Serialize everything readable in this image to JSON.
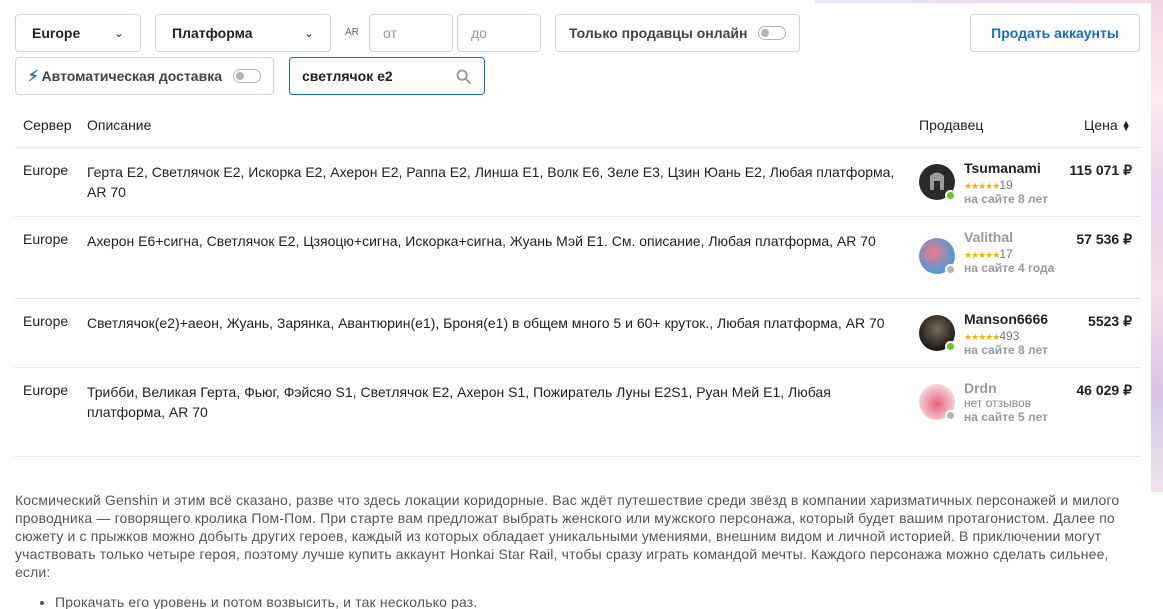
{
  "filters": {
    "server_selected": "Europe",
    "platform_selected": "Платформа",
    "ar_label": "AR",
    "ar_from_placeholder": "от",
    "ar_to_placeholder": "до",
    "online_only_label": "Только продавцы онлайн",
    "auto_delivery_label": "Автоматическая доставка",
    "search_value": "светлячок е2"
  },
  "sell_button_label": "Продать аккаунты",
  "table": {
    "headers": {
      "server": "Сервер",
      "description": "Описание",
      "seller": "Продавец",
      "price": "Цена"
    },
    "rows": [
      {
        "server": "Europe",
        "description": "Герта E2, Светлячок E2, Искорка E2, Ахерон E2, Раппа E2, Линша E1, Волк E6, Зеле E3, Цзин Юань E2, Любая платформа, AR 70",
        "seller_name": "Tsumanami",
        "stars": "★★★★★",
        "reviews": "19",
        "seller_since": "на сайте 8 лет",
        "online": true,
        "price": "115 071 ₽"
      },
      {
        "server": "Europe",
        "description": "Ахерон E6+сигна, Светлячок E2, Цзяоцю+сигна, Искорка+сигна, Жуань Мэй E1. См. описание, Любая платформа, AR 70",
        "seller_name": "Valithal",
        "stars": "★★★★★",
        "reviews": "17",
        "seller_since": "на сайте 4 года",
        "online": false,
        "price": "57 536 ₽"
      },
      {
        "server": "Europe",
        "description": "Светлячок(е2)+аеон, Жуань, Зарянка, Авантюрин(е1), Броня(е1) в общем много 5 и 60+ круток., Любая платформа, AR 70",
        "seller_name": "Manson6666",
        "stars": "★★★★★",
        "reviews": "493",
        "seller_since": "на сайте 8 лет",
        "online": true,
        "price": "5523 ₽"
      },
      {
        "server": "Europe",
        "description": "Трибби, Великая Герта, Фьюг, Фэйсяо S1, Светлячок E2, Ахерон S1, Пожиратель Луны E2S1, Руан Мей E1, Любая платформа, AR 70",
        "seller_name": "Drdn",
        "stars": "",
        "reviews": "нет отзывов",
        "seller_since": "на сайте 5 лет",
        "online": false,
        "price": "46 029 ₽"
      }
    ]
  },
  "about": {
    "paragraph": "Космический Genshin и этим всё сказано, разве что здесь локации коридорные. Вас ждёт путешествие среди звёзд в компании харизматичных персонажей и милого проводника — говорящего кролика Пом-Пом. При старте вам предложат выбрать женского или мужского персонажа, который будет вашим протагонистом. Далее по сюжету и с прыжков можно добыть других героев, каждый из которых обладает уникальными умениями, внешним видом и личной историей. В приключении могут участвовать только четыре героя, поэтому лучше купить аккаунт Honkai Star Rail, чтобы сразу играть командой мечты. Каждого персонажа можно сделать сильнее, если:",
    "bullet_1": "Прокачать его уровень и потом возвысить, и так несколько раз."
  },
  "colors": {
    "accent": "#1a6ec0",
    "online": "#6cc230",
    "offline": "#b5b5b5",
    "star": "#f0b400"
  }
}
